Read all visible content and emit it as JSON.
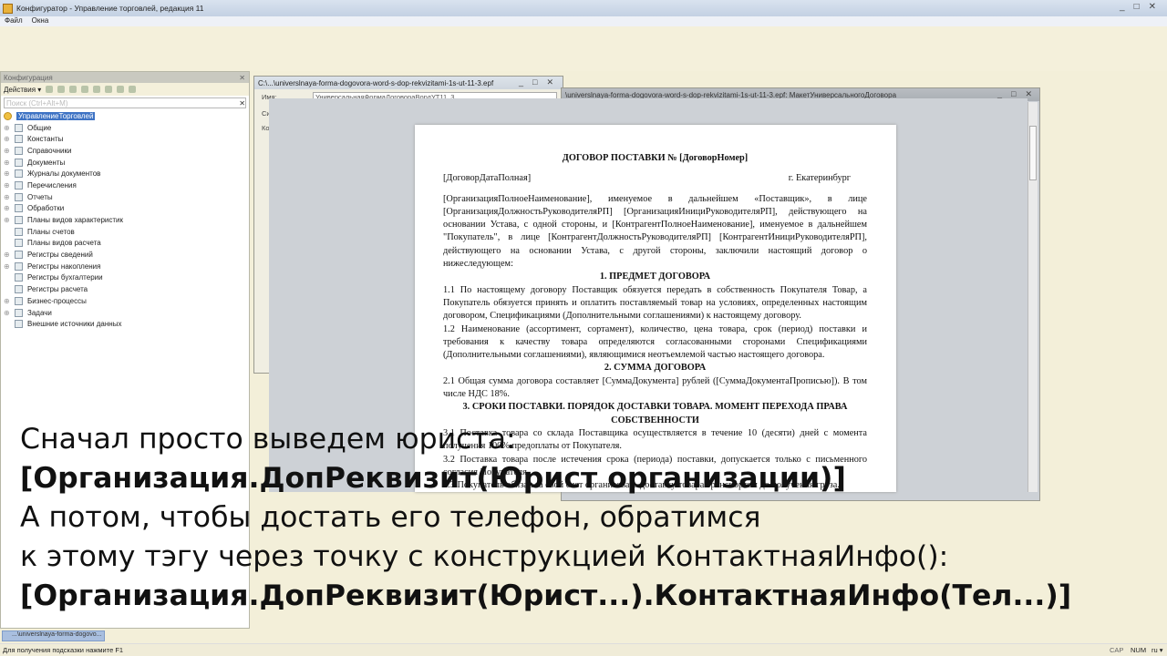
{
  "window": {
    "title": "Конфигуратор - Управление торговлей, редакция 11"
  },
  "menu": [
    "Файл",
    "Окна"
  ],
  "config_panel": {
    "title": "Конфигурация",
    "actions_label": "Действия ▾",
    "search_placeholder": "Поиск (Ctrl+Alt+M)",
    "tree": [
      "УправлениеТорговлей",
      "Общие",
      "Константы",
      "Справочники",
      "Документы",
      "Журналы документов",
      "Перечисления",
      "Отчеты",
      "Обработки",
      "Планы видов характеристик",
      "Планы счетов",
      "Планы видов расчета",
      "Регистры сведений",
      "Регистры накопления",
      "Регистры бухгалтерии",
      "Регистры расчета",
      "Бизнес-процессы",
      "Задачи",
      "Внешние источники данных"
    ],
    "expandable": [
      false,
      true,
      true,
      true,
      true,
      true,
      true,
      true,
      true,
      true,
      false,
      false,
      true,
      true,
      false,
      false,
      true,
      true,
      false
    ]
  },
  "epf_window": {
    "title": "C:\\...\\universlnaya-forma-dogovora-word-s-dop-rekvizitami-1s-ut-11-3.epf",
    "name_label": "Имя:",
    "name_value": "УниверсальнаяФормаДоговораВордУТ11_3",
    "label_s": "Си",
    "label_k": "Ко"
  },
  "maket_window": {
    "title": "\\universlnaya-forma-dogovora-word-s-dop-rekvizitami-1s-ut-11-3.epf: МакетУниверсальногоДоговора"
  },
  "document": {
    "title": "ДОГОВОР ПОСТАВКИ №  [ДоговорНомер]",
    "date": "[ДоговорДатаПолная]",
    "city": "г. Екатеринбург",
    "intro": "[ОрганизацияПолноеНаименование], именуемое в дальнейшем «Поставщик», в лице [ОрганизацияДолжностьРуководителяРП] [ОрганизацияИнициРуководителяРП], действующего на основании Устава, с одной стороны, и [КонтрагентПолноеНаименование], именуемое в дальнейшем \"Покупатель\", в лице [КонтрагентДолжностьРуководителяРП] [КонтрагентИнициРуководителяРП], действующего на основании Устава, с другой стороны, заключили настоящий договор о нижеследующем:",
    "s1": "1. ПРЕДМЕТ ДОГОВОРА",
    "p11": "1.1 По настоящему договору Поставщик обязуется передать в собственность Покупателя Товар, а Покупатель обязуется принять и оплатить поставляемый товар на условиях, определенных настоящим договором, Спецификациями (Дополнительными соглашениями) к настоящему договору.",
    "p12": "1.2 Наименование (ассортимент, сортамент), количество, цена товара, срок (период) поставки и требования к качеству товара определяются согласованными сторонами Спецификациями (Дополнительными соглашениями), являющимися неотъемлемой частью настоящего договора.",
    "s2": "2. СУММА ДОГОВОРА",
    "p21": "2.1 Общая сумма договора составляет [СуммаДокумента] рублей ([СуммаДокументаПрописью]). В том числе НДС 18%.",
    "s3": "3. СРОКИ ПОСТАВКИ. ПОРЯДОК ДОСТАВКИ ТОВАРА. МОМЕНТ ПЕРЕХОДА ПРАВА СОБСТВЕННОСТИ",
    "p31": "3.1 Поставка товара со склада Поставщика осуществляется в течение 10 (десяти) дней с момента получения 100% предоплаты от Покупателя.",
    "p32": "3.2 Поставка товара после истечения срока (периода) поставки, допускается только с письменного согласия Покупателя.",
    "p33": "3.3 Покупатель обязан за свой счет организовать доставку товара транспортом до получения груза."
  },
  "caption": [
    "Сначал просто выведем юриста:",
    "[Организация.ДопРеквизит(Юрист организации)]",
    "А потом, чтобы достать его телефон, обратимся",
    "к этому тэгу через точку с конструкцией КонтактнаяИнфо():",
    "[Организация.ДопРеквизит(Юрист...).КонтактнаяИнфо(Тел...)]"
  ],
  "taskbar": {
    "item": "...\\universlnaya-forma-dogovo..."
  },
  "status": {
    "hint": "Для получения подсказки нажмите F1",
    "cap": "CAP",
    "num": "NUM",
    "lang": "ru ▾"
  }
}
